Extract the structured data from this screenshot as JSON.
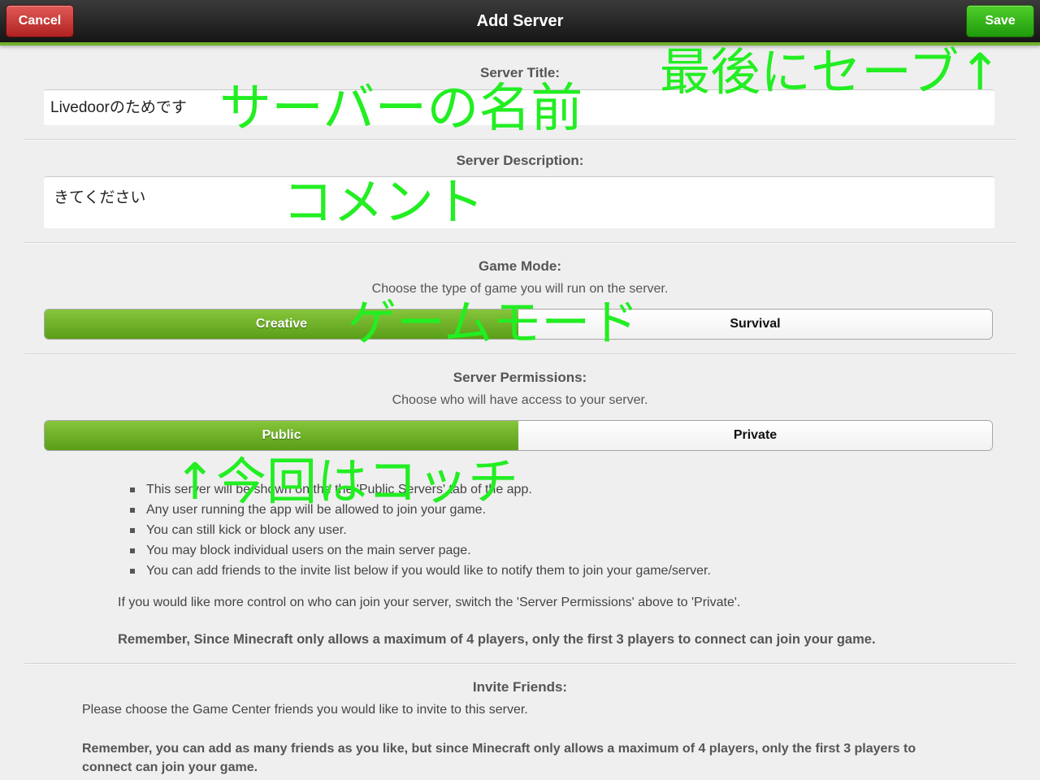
{
  "header": {
    "title": "Add Server",
    "cancel_label": "Cancel",
    "save_label": "Save"
  },
  "server_title": {
    "label": "Server Title:",
    "value": "Livedoorのためです"
  },
  "server_description": {
    "label": "Server Description:",
    "value": "きてください"
  },
  "game_mode": {
    "label": "Game Mode:",
    "hint": "Choose the type of game you will run on the server.",
    "options": [
      "Creative",
      "Survival"
    ],
    "selected": "Creative"
  },
  "server_permissions": {
    "label": "Server Permissions:",
    "hint": "Choose who will have access to your server.",
    "options": [
      "Public",
      "Private"
    ],
    "selected": "Public",
    "bullets": [
      "This server will be shown on the the 'Public Servers' tab of the app.",
      "Any user running the app will be allowed to join your game.",
      "You can still kick or block any user.",
      "You may block individual users on the main server page.",
      "You can add friends to the invite list below if you would like to notify them to join your game/server."
    ],
    "note": "If you would like more control on who can join your server, switch the 'Server Permissions' above to 'Private'.",
    "reminder": "Remember, Since Minecraft only allows a maximum of 4 players, only the first 3 players to connect can join your game."
  },
  "invite_friends": {
    "label": "Invite Friends:",
    "hint": "Please choose the Game Center friends you would like to invite to this server.",
    "reminder": "Remember, you can add as many friends as you like, but since Minecraft only allows a maximum of 4 players, only the first 3 players to connect can join your game."
  },
  "annotations": {
    "save_note": "最後にセーブ↑",
    "title_note": "サーバーの名前",
    "description_note": "コメント",
    "game_mode_note": "ゲームモード",
    "permission_note": "↑今回はコッチ"
  },
  "colors": {
    "accent_green": "#6fb12a",
    "annotation_green": "#22ee22",
    "cancel_red": "#b02221",
    "save_green": "#1f9a0d"
  }
}
